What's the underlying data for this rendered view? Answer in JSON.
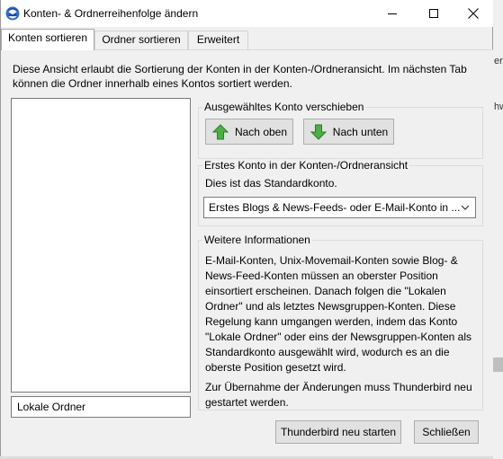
{
  "window": {
    "title": "Konten- & Ordnerreihenfolge ändern"
  },
  "tabs": [
    {
      "label": "Konten sortieren",
      "active": true
    },
    {
      "label": "Ordner sortieren",
      "active": false
    },
    {
      "label": "Erweitert",
      "active": false
    }
  ],
  "description": "Diese Ansicht erlaubt die Sortierung der Konten in der Konten-/Ordneransicht. Im nächsten Tab können die Ordner innerhalb eines Kontos sortiert werden.",
  "account_list": {
    "items": []
  },
  "selected_account": "Lokale Ordner",
  "move_group": {
    "label": "Ausgewähltes Konto verschieben",
    "up_label": "Nach oben",
    "down_label": "Nach unten"
  },
  "first_account_group": {
    "label": "Erstes Konto in der Konten-/Ordneransicht",
    "text": "Dies ist das Standardkonto.",
    "select_value": "Erstes Blogs & News-Feeds- oder E-Mail-Konto in ..."
  },
  "info_group": {
    "label": "Weitere Informationen",
    "paragraph1": "E-Mail-Konten, Unix-Movemail-Konten sowie Blog- & News-Feed-Konten müssen an oberster Position einsortiert erscheinen. Danach folgen die \"Lokalen Ordner\" und als letztes Newsgruppen-Konten. Diese Regelung kann umgangen werden, indem das Konto \"Lokale Ordner\" oder eins der Newsgruppen-Konten als Standardkonto ausgewählt wird, wodurch es an die oberste Position gesetzt wird.",
    "paragraph2": "Zur Übernahme der Änderungen muss Thunderbird neu gestartet werden."
  },
  "footer": {
    "restart_label": "Thunderbird neu starten",
    "close_label": "Schließen"
  },
  "background_fragments": [
    "er",
    "hw"
  ],
  "colors": {
    "accent_green": "#3fa83a",
    "window_bg": "#f0f0f0",
    "button_bg": "#e1e1e1"
  },
  "icons": {
    "app": "thunderbird-icon",
    "up": "arrow-up-icon",
    "down": "arrow-down-icon"
  }
}
